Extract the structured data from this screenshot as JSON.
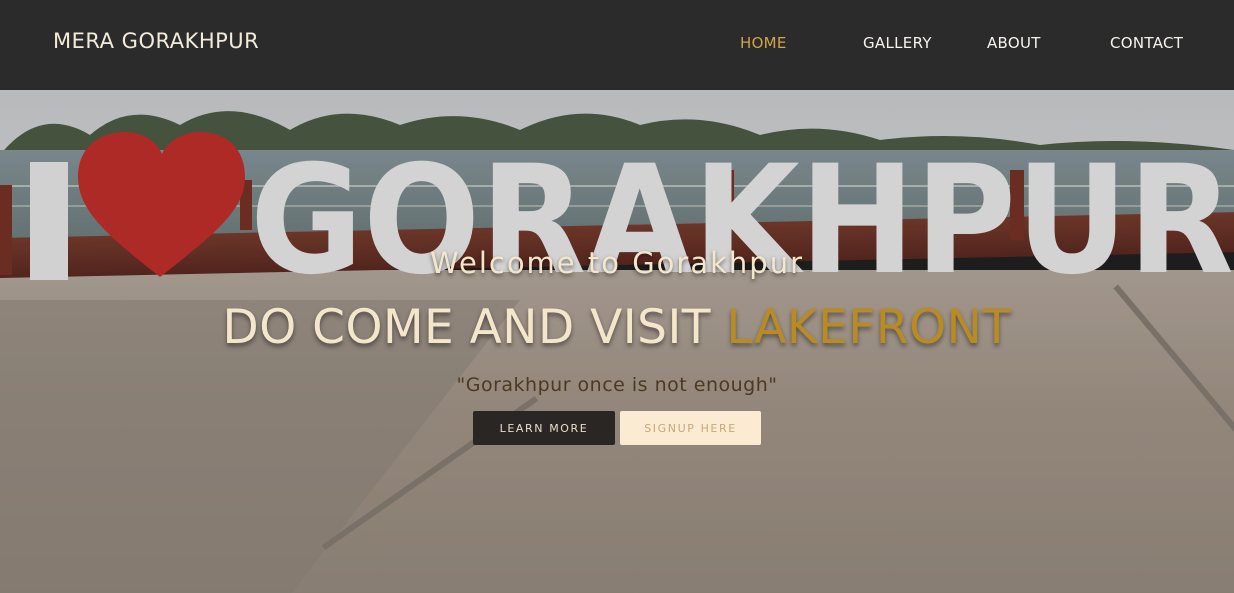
{
  "navbar": {
    "brand": "MERA GORAKHPUR",
    "links": [
      "HOME",
      "GALLERY",
      "ABOUT",
      "CONTACT"
    ],
    "active": "HOME"
  },
  "hero": {
    "welcome": "Welcome to Gorakhpur",
    "headline_main": "DO COME AND VISIT ",
    "headline_accent": "LAKEFRONT",
    "quote": "\"Gorakhpur once is not enough\"",
    "learn_more": "LEARN MORE",
    "signup": "SIGNUP HERE"
  },
  "background": {
    "sign_text": "I ♥ GORAKHPUR"
  },
  "colors": {
    "accent": "#b98b25",
    "nav_active": "#d3a446",
    "navbar_bg": "#262626",
    "cream": "#f3e6cb"
  }
}
